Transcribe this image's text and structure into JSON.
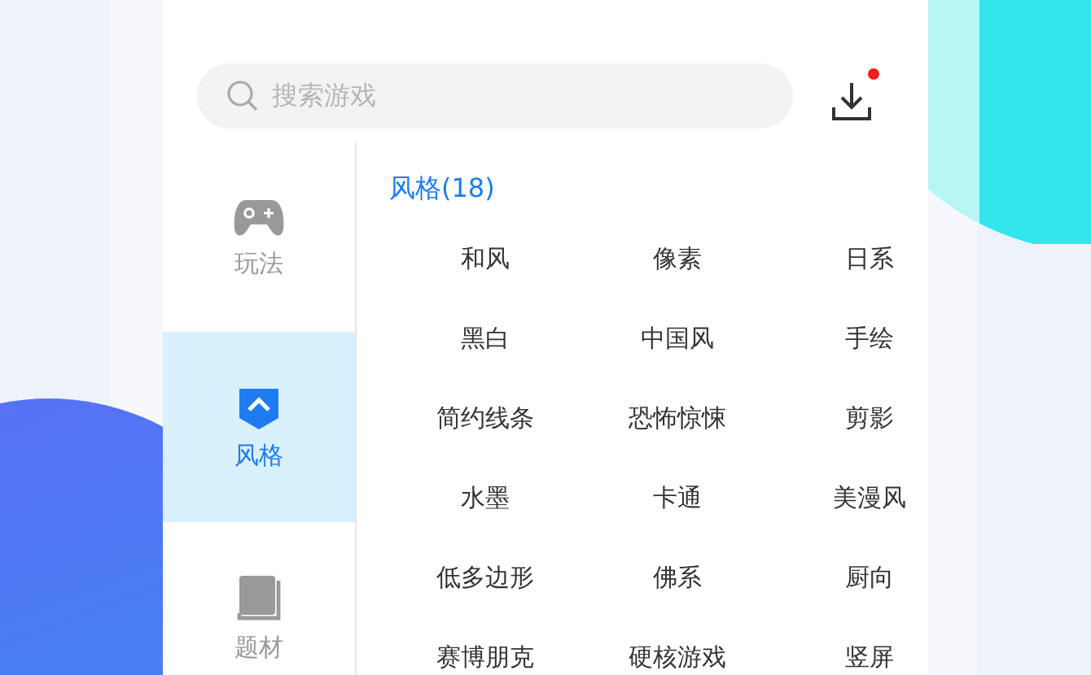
{
  "search": {
    "placeholder": "搜索游戏"
  },
  "download": {
    "has_notification": true
  },
  "sidebar": {
    "items": [
      {
        "label": "玩法",
        "kind": "gamepad",
        "selected": false
      },
      {
        "label": "风格",
        "kind": "style",
        "selected": true
      },
      {
        "label": "题材",
        "kind": "book",
        "selected": false
      }
    ]
  },
  "section": {
    "title": "风格(18)",
    "tags": [
      "和风",
      "像素",
      "日系",
      "黑白",
      "中国风",
      "手绘",
      "简约线条",
      "恐怖惊悚",
      "剪影",
      "水墨",
      "卡通",
      "美漫风",
      "低多边形",
      "佛系",
      "厨向",
      "赛博朋克",
      "硬核游戏",
      "竖屏"
    ]
  }
}
